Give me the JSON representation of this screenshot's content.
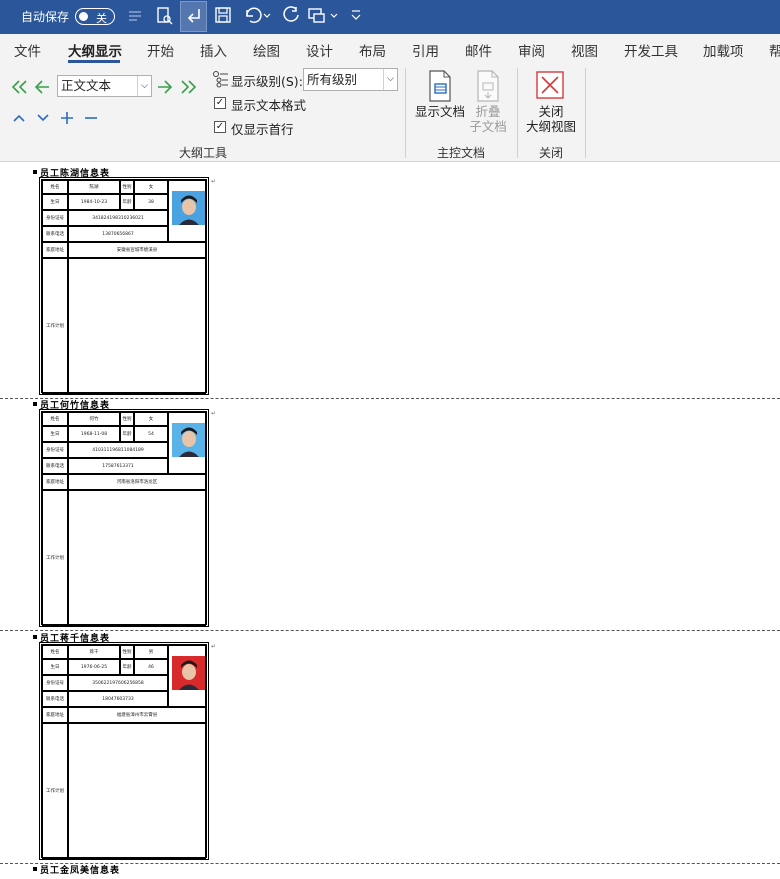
{
  "titlebar": {
    "autosave_label": "自动保存",
    "autosave_state": "关",
    "qat_icons": [
      "pen-icon",
      "print-preview-icon",
      "return-icon",
      "save-icon",
      "undo-icon",
      "redo-icon",
      "format-painter-icon",
      "customize-icon"
    ]
  },
  "menu": {
    "tabs": [
      "文件",
      "大纲显示",
      "开始",
      "插入",
      "绘图",
      "设计",
      "布局",
      "引用",
      "邮件",
      "审阅",
      "视图",
      "开发工具",
      "加载项",
      "帮"
    ],
    "active": "大纲显示"
  },
  "ribbon": {
    "outline_tools": {
      "style_value": "正文文本",
      "show_level_label": "显示级别(S):",
      "show_level_value": "所有级别",
      "show_text_format": "显示文本格式",
      "show_first_line_only": "仅显示首行",
      "show_text_format_checked": true,
      "show_first_line_only_checked": true,
      "group_label": "大纲工具"
    },
    "master_document": {
      "show_document": "显示文档",
      "collapse_line1": "折叠",
      "collapse_line2": "子文档",
      "group_label": "主控文档"
    },
    "close": {
      "close_line1": "关闭",
      "close_line2": "大纲视图",
      "group_label": "关闭"
    },
    "colors": {
      "accent": "#2b579a",
      "green_arrow": "#3aa04a",
      "blue_arrow": "#2b6cc4",
      "close_red": "#d43b3b"
    }
  },
  "document": {
    "sections": [
      {
        "title": "员工陈湖信息表",
        "name_label": "姓名",
        "name": "陈湖",
        "gender_label": "性别",
        "gender": "女",
        "birth_label": "生日",
        "birth": "1984-10-23",
        "age_label": "年龄",
        "age": "38",
        "id_label": "身份证号",
        "id": "341824198310236021",
        "phone_label": "联系电话",
        "phone": "13870656867",
        "address_label": "家庭地址",
        "address": "安徽省宣城市绩溪县",
        "plan_label": "工作计划",
        "photo_bg": "#4aa3e0"
      },
      {
        "title": "员工何竹信息表",
        "name_label": "姓名",
        "name": "何竹",
        "gender_label": "性别",
        "gender": "女",
        "birth_label": "生日",
        "birth": "1968-11-08",
        "age_label": "年龄",
        "age": "54",
        "id_label": "身份证号",
        "id": "410311196811084189",
        "phone_label": "联系电话",
        "phone": "17587613371",
        "address_label": "家庭地址",
        "address": "河南省洛阳市洛龙区",
        "plan_label": "工作计划",
        "photo_bg": "#5ab3e8"
      },
      {
        "title": "员工蒋千信息表",
        "name_label": "姓名",
        "name": "蒋千",
        "gender_label": "性别",
        "gender": "男",
        "birth_label": "生日",
        "birth": "1976-06-25",
        "age_label": "年龄",
        "age": "46",
        "id_label": "身份证号",
        "id": "350622197606256858",
        "phone_label": "联系电话",
        "phone": "18047603733",
        "address_label": "家庭地址",
        "address": "福建省漳州市云霄县",
        "plan_label": "工作计划",
        "photo_bg": "#d82a2a"
      },
      {
        "title": "员工金凤美信息表"
      }
    ]
  }
}
